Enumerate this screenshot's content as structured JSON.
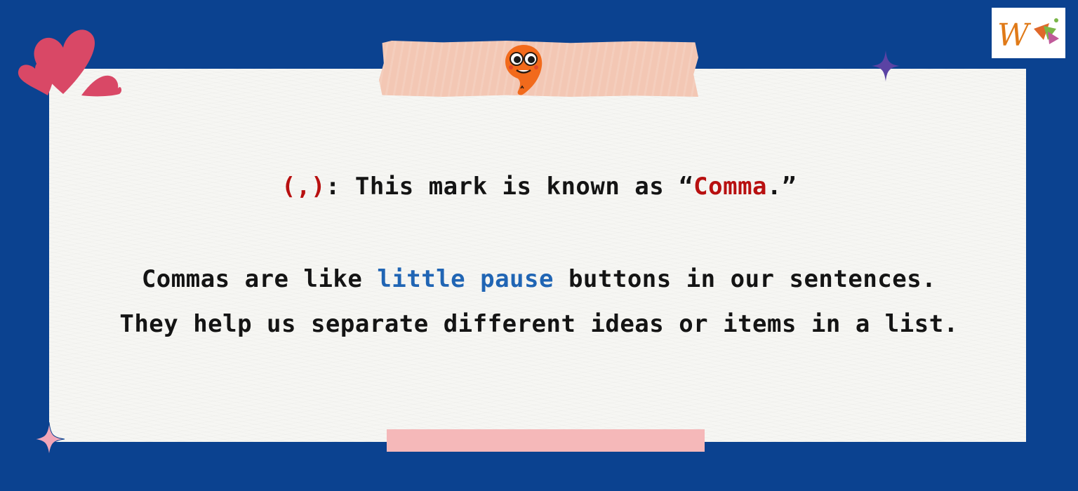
{
  "logo": {
    "text": "W"
  },
  "definition": {
    "symbol": "(,)",
    "text": ": This mark is known as “",
    "term": "Comma",
    "end": ".”"
  },
  "explanation": {
    "line1_pre": "Commas are like ",
    "line1_highlight": "little pause",
    "line1_post": " buttons in our sentences.",
    "line2": "They help us separate different ideas or items in a list."
  },
  "colors": {
    "background": "#0b4290",
    "paper": "#f6f6f3",
    "highlight_red": "#b81010",
    "highlight_blue": "#2065b4",
    "tape_top": "#f3c7b4",
    "tape_bottom": "#f5b8b9",
    "hearts": "#d94866",
    "sparkle_purple": "#5b43a4",
    "sparkle_pink": "#f2a6b8",
    "mascot": "#f26a1b"
  },
  "icons": [
    "hearts-icon",
    "comma-mascot-icon",
    "sparkle-icon",
    "logo-icon"
  ]
}
